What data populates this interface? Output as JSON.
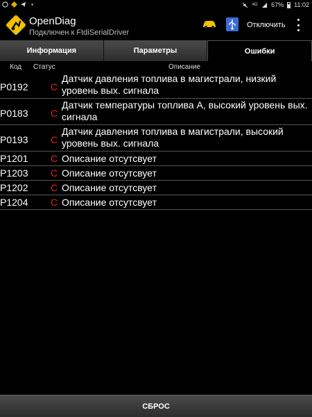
{
  "statusbar": {
    "left_icons": [
      "whatsapp-icon",
      "navigation-icon",
      "telegram-icon",
      "more-dots-icon"
    ],
    "right_icons": [
      "mute-icon",
      "network-4g-icon",
      "signal-icon"
    ],
    "battery": "67%",
    "time": "11:02"
  },
  "actionbar": {
    "title": "OpenDiag",
    "subtitle": "Подключен к FtdiSerialDriver",
    "disconnect_label": "Отключить"
  },
  "tabs": [
    {
      "label": "Информация",
      "selected": false
    },
    {
      "label": "Параметры",
      "selected": false
    },
    {
      "label": "Ошибки",
      "selected": true
    }
  ],
  "table": {
    "headers": {
      "code": "Код",
      "status": "Статус",
      "description": "Описание"
    },
    "rows": [
      {
        "code": "P0192",
        "status": "C",
        "description": "Датчик давления топлива в магистрали, низкий уровень вых. сигнала"
      },
      {
        "code": "P0183",
        "status": "C",
        "description": "Датчик температуры топлива А, высокий уровень вых. сигнала"
      },
      {
        "code": "P0193",
        "status": "C",
        "description": "Датчик давления топлива в магистрали, высокий уровень вых. сигнала"
      },
      {
        "code": "P1201",
        "status": "C",
        "description": "Описание отсутсвует"
      },
      {
        "code": "P1203",
        "status": "C",
        "description": "Описание отсутсвует"
      },
      {
        "code": "P1202",
        "status": "C",
        "description": "Описание отсутсвует"
      },
      {
        "code": "P1204",
        "status": "C",
        "description": "Описание отсутсвует"
      }
    ]
  },
  "footer": {
    "reset_label": "СБРОС"
  },
  "colors": {
    "status_error": "#e02020",
    "background": "#000000",
    "tab_gradient_top": "#4a4a4a",
    "tab_gradient_bottom": "#2d2d2d"
  }
}
